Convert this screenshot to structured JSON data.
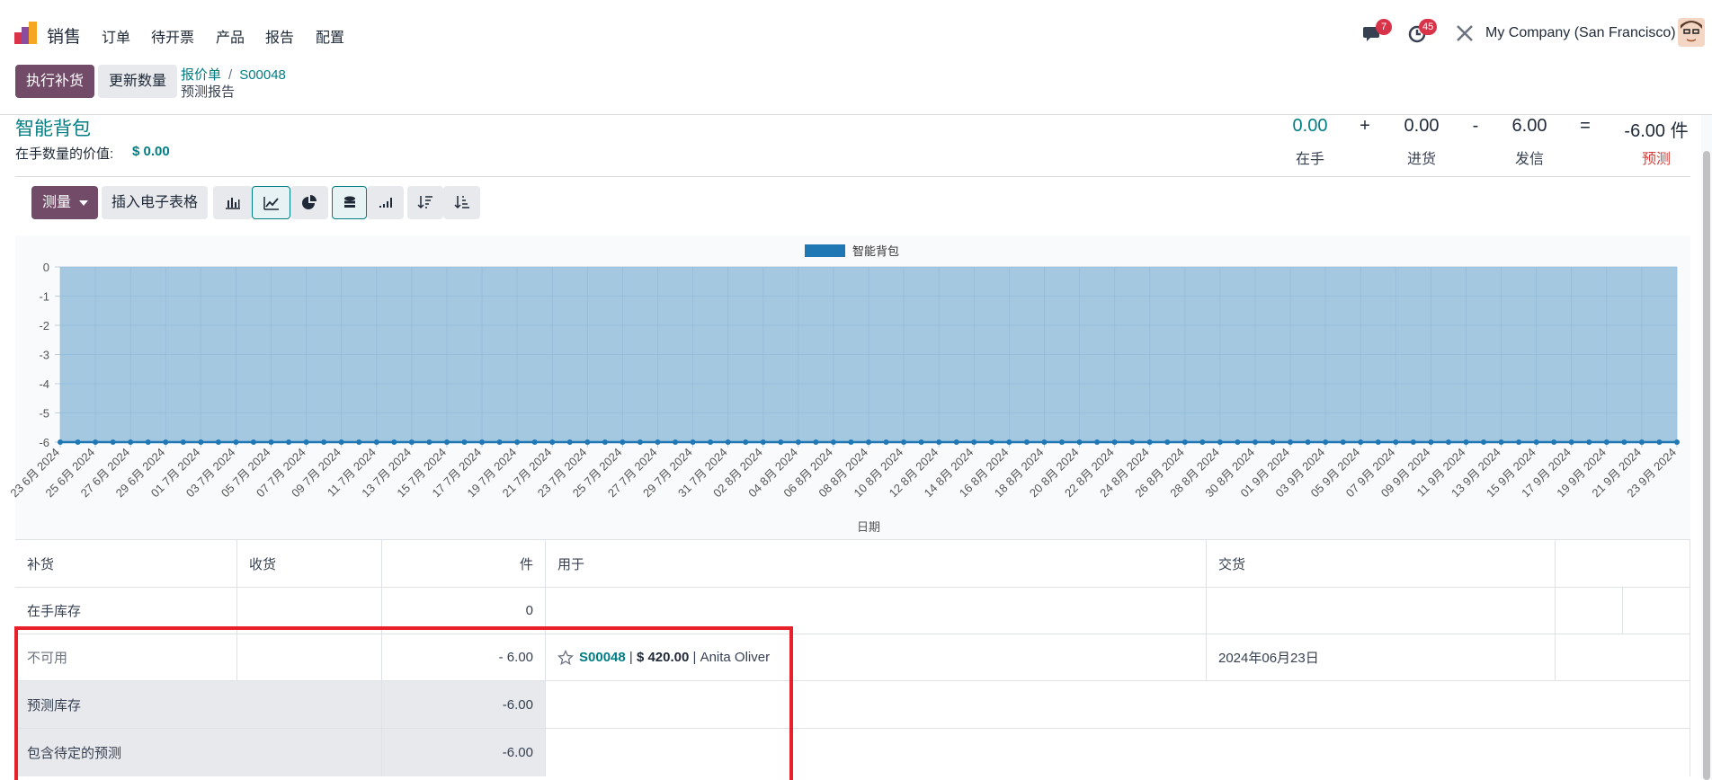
{
  "nav": {
    "app_name": "销售",
    "menu": [
      "订单",
      "待开票",
      "产品",
      "报告",
      "配置"
    ],
    "messages_badge": "7",
    "activities_badge": "45",
    "company": "My Company (San Francisco)"
  },
  "control_panel": {
    "primary_button": "执行补货",
    "secondary_button": "更新数量",
    "breadcrumb_parent": "报价单",
    "breadcrumb_separator": "/",
    "breadcrumb_record": "S00048",
    "breadcrumb_current": "预测报告"
  },
  "product": {
    "name": "智能背包",
    "value_label": "在手数量的价值:",
    "value_amount": "$ 0.00"
  },
  "summary": {
    "on_hand": "0.00",
    "op1": "+",
    "incoming": "0.00",
    "op2": "-",
    "outgoing": "6.00",
    "op3": "=",
    "forecast": "-6.00 件",
    "on_hand_label": "在手",
    "incoming_label": "进货",
    "outgoing_label": "发信",
    "forecast_label": "预测"
  },
  "toolbar": {
    "measure_label": "测量",
    "insert_label": "插入电子表格",
    "icons": [
      "bar-chart-icon",
      "line-chart-icon",
      "pie-chart-icon",
      "stacked-icon",
      "cumulative-icon",
      "sort-desc-icon",
      "sort-asc-icon"
    ]
  },
  "chart_data": {
    "type": "area",
    "legend": "智能背包",
    "legend_position": "top-center",
    "xlabel": "日期",
    "ylabel": "",
    "ylim": [
      -6,
      0
    ],
    "yticks": [
      "0",
      "-1",
      "-2",
      "-3",
      "-4",
      "-5",
      "-6"
    ],
    "grid": true,
    "color": "#1f77b4",
    "fill_color": "#a5c8e1",
    "x": [
      "23 6月 2024",
      "24 6月 2024",
      "25 6月 2024",
      "26 6月 2024",
      "27 6月 2024",
      "28 6月 2024",
      "29 6月 2024",
      "30 6月 2024",
      "01 7月 2024",
      "02 7月 2024",
      "03 7月 2024",
      "04 7月 2024",
      "05 7月 2024",
      "06 7月 2024",
      "07 7月 2024",
      "08 7月 2024",
      "09 7月 2024",
      "10 7月 2024",
      "11 7月 2024",
      "12 7月 2024",
      "13 7月 2024",
      "14 7月 2024",
      "15 7月 2024",
      "16 7月 2024",
      "17 7月 2024",
      "18 7月 2024",
      "19 7月 2024",
      "20 7月 2024",
      "21 7月 2024",
      "22 7月 2024",
      "23 7月 2024",
      "24 7月 2024",
      "25 7月 2024",
      "26 7月 2024",
      "27 7月 2024",
      "28 7月 2024",
      "29 7月 2024",
      "30 7月 2024",
      "31 7月 2024",
      "01 8月 2024",
      "02 8月 2024",
      "03 8月 2024",
      "04 8月 2024",
      "05 8月 2024",
      "06 8月 2024",
      "07 8月 2024",
      "08 8月 2024",
      "09 8月 2024",
      "10 8月 2024",
      "11 8月 2024",
      "12 8月 2024",
      "13 8月 2024",
      "14 8月 2024",
      "15 8月 2024",
      "16 8月 2024",
      "17 8月 2024",
      "18 8月 2024",
      "19 8月 2024",
      "20 8月 2024",
      "21 8月 2024",
      "22 8月 2024",
      "23 8月 2024",
      "24 8月 2024",
      "25 8月 2024",
      "26 8月 2024",
      "27 8月 2024",
      "28 8月 2024",
      "29 8月 2024",
      "30 8月 2024",
      "31 8月 2024",
      "01 9月 2024",
      "02 9月 2024",
      "03 9月 2024",
      "04 9月 2024",
      "05 9月 2024",
      "06 9月 2024",
      "07 9月 2024",
      "08 9月 2024",
      "09 9月 2024",
      "10 9月 2024",
      "11 9月 2024",
      "12 9月 2024",
      "13 9月 2024",
      "14 9月 2024",
      "15 9月 2024",
      "16 9月 2024",
      "17 9月 2024",
      "18 9月 2024",
      "19 9月 2024",
      "20 9月 2024",
      "21 9月 2024",
      "22 9月 2024",
      "23 9月 2024"
    ],
    "x_labels_shown": [
      "23 6月 2024",
      "25 6月 2024",
      "27 6月 2024",
      "29 6月 2024",
      "01 7月 2024",
      "03 7月 2024",
      "05 7月 2024",
      "07 7月 2024",
      "09 7月 2024",
      "11 7月 2024",
      "13 7月 2024",
      "15 7月 2024",
      "17 7月 2024",
      "19 7月 2024",
      "21 7月 2024",
      "23 7月 2024",
      "25 7月 2024",
      "27 7月 2024",
      "29 7月 2024",
      "31 7月 2024",
      "02 8月 2024",
      "04 8月 2024",
      "06 8月 2024",
      "08 8月 2024",
      "10 8月 2024",
      "12 8月 2024",
      "14 8月 2024",
      "16 8月 2024",
      "18 8月 2024",
      "20 8月 2024",
      "22 8月 2024",
      "24 8月 2024",
      "26 8月 2024",
      "28 8月 2024",
      "30 8月 2024",
      "01 9月 2024",
      "03 9月 2024",
      "05 9月 2024",
      "07 9月 2024",
      "09 9月 2024",
      "11 9月 2024",
      "13 9月 2024",
      "15 9月 2024",
      "17 9月 2024",
      "19 9月 2024",
      "21 9月 2024",
      "23 9月 2024"
    ],
    "series": [
      {
        "name": "智能背包",
        "values": [
          -6,
          -6,
          -6,
          -6,
          -6,
          -6,
          -6,
          -6,
          -6,
          -6,
          -6,
          -6,
          -6,
          -6,
          -6,
          -6,
          -6,
          -6,
          -6,
          -6,
          -6,
          -6,
          -6,
          -6,
          -6,
          -6,
          -6,
          -6,
          -6,
          -6,
          -6,
          -6,
          -6,
          -6,
          -6,
          -6,
          -6,
          -6,
          -6,
          -6,
          -6,
          -6,
          -6,
          -6,
          -6,
          -6,
          -6,
          -6,
          -6,
          -6,
          -6,
          -6,
          -6,
          -6,
          -6,
          -6,
          -6,
          -6,
          -6,
          -6,
          -6,
          -6,
          -6,
          -6,
          -6,
          -6,
          -6,
          -6,
          -6,
          -6,
          -6,
          -6,
          -6,
          -6,
          -6,
          -6,
          -6,
          -6,
          -6,
          -6,
          -6,
          -6,
          -6,
          -6,
          -6,
          -6,
          -6,
          -6,
          -6,
          -6,
          -6,
          -6,
          -6
        ]
      }
    ]
  },
  "table": {
    "headers": [
      "补货",
      "收货",
      "件",
      "用于",
      "交货",
      ""
    ],
    "on_hand_row": {
      "label": "在手库存",
      "qty": "0"
    },
    "unavailable_row": {
      "label": "不可用",
      "qty": "- 6.00",
      "order": "S00048",
      "sep1": " | ",
      "amount": "$ 420.00",
      "sep2": " | ",
      "customer": "Anita Oliver",
      "delivery": "2024年06月23日"
    },
    "forecast_row": {
      "label": "预测库存",
      "qty": "-6.00"
    },
    "pending_row": {
      "label": "包含待定的预测",
      "qty": "-6.00"
    }
  }
}
